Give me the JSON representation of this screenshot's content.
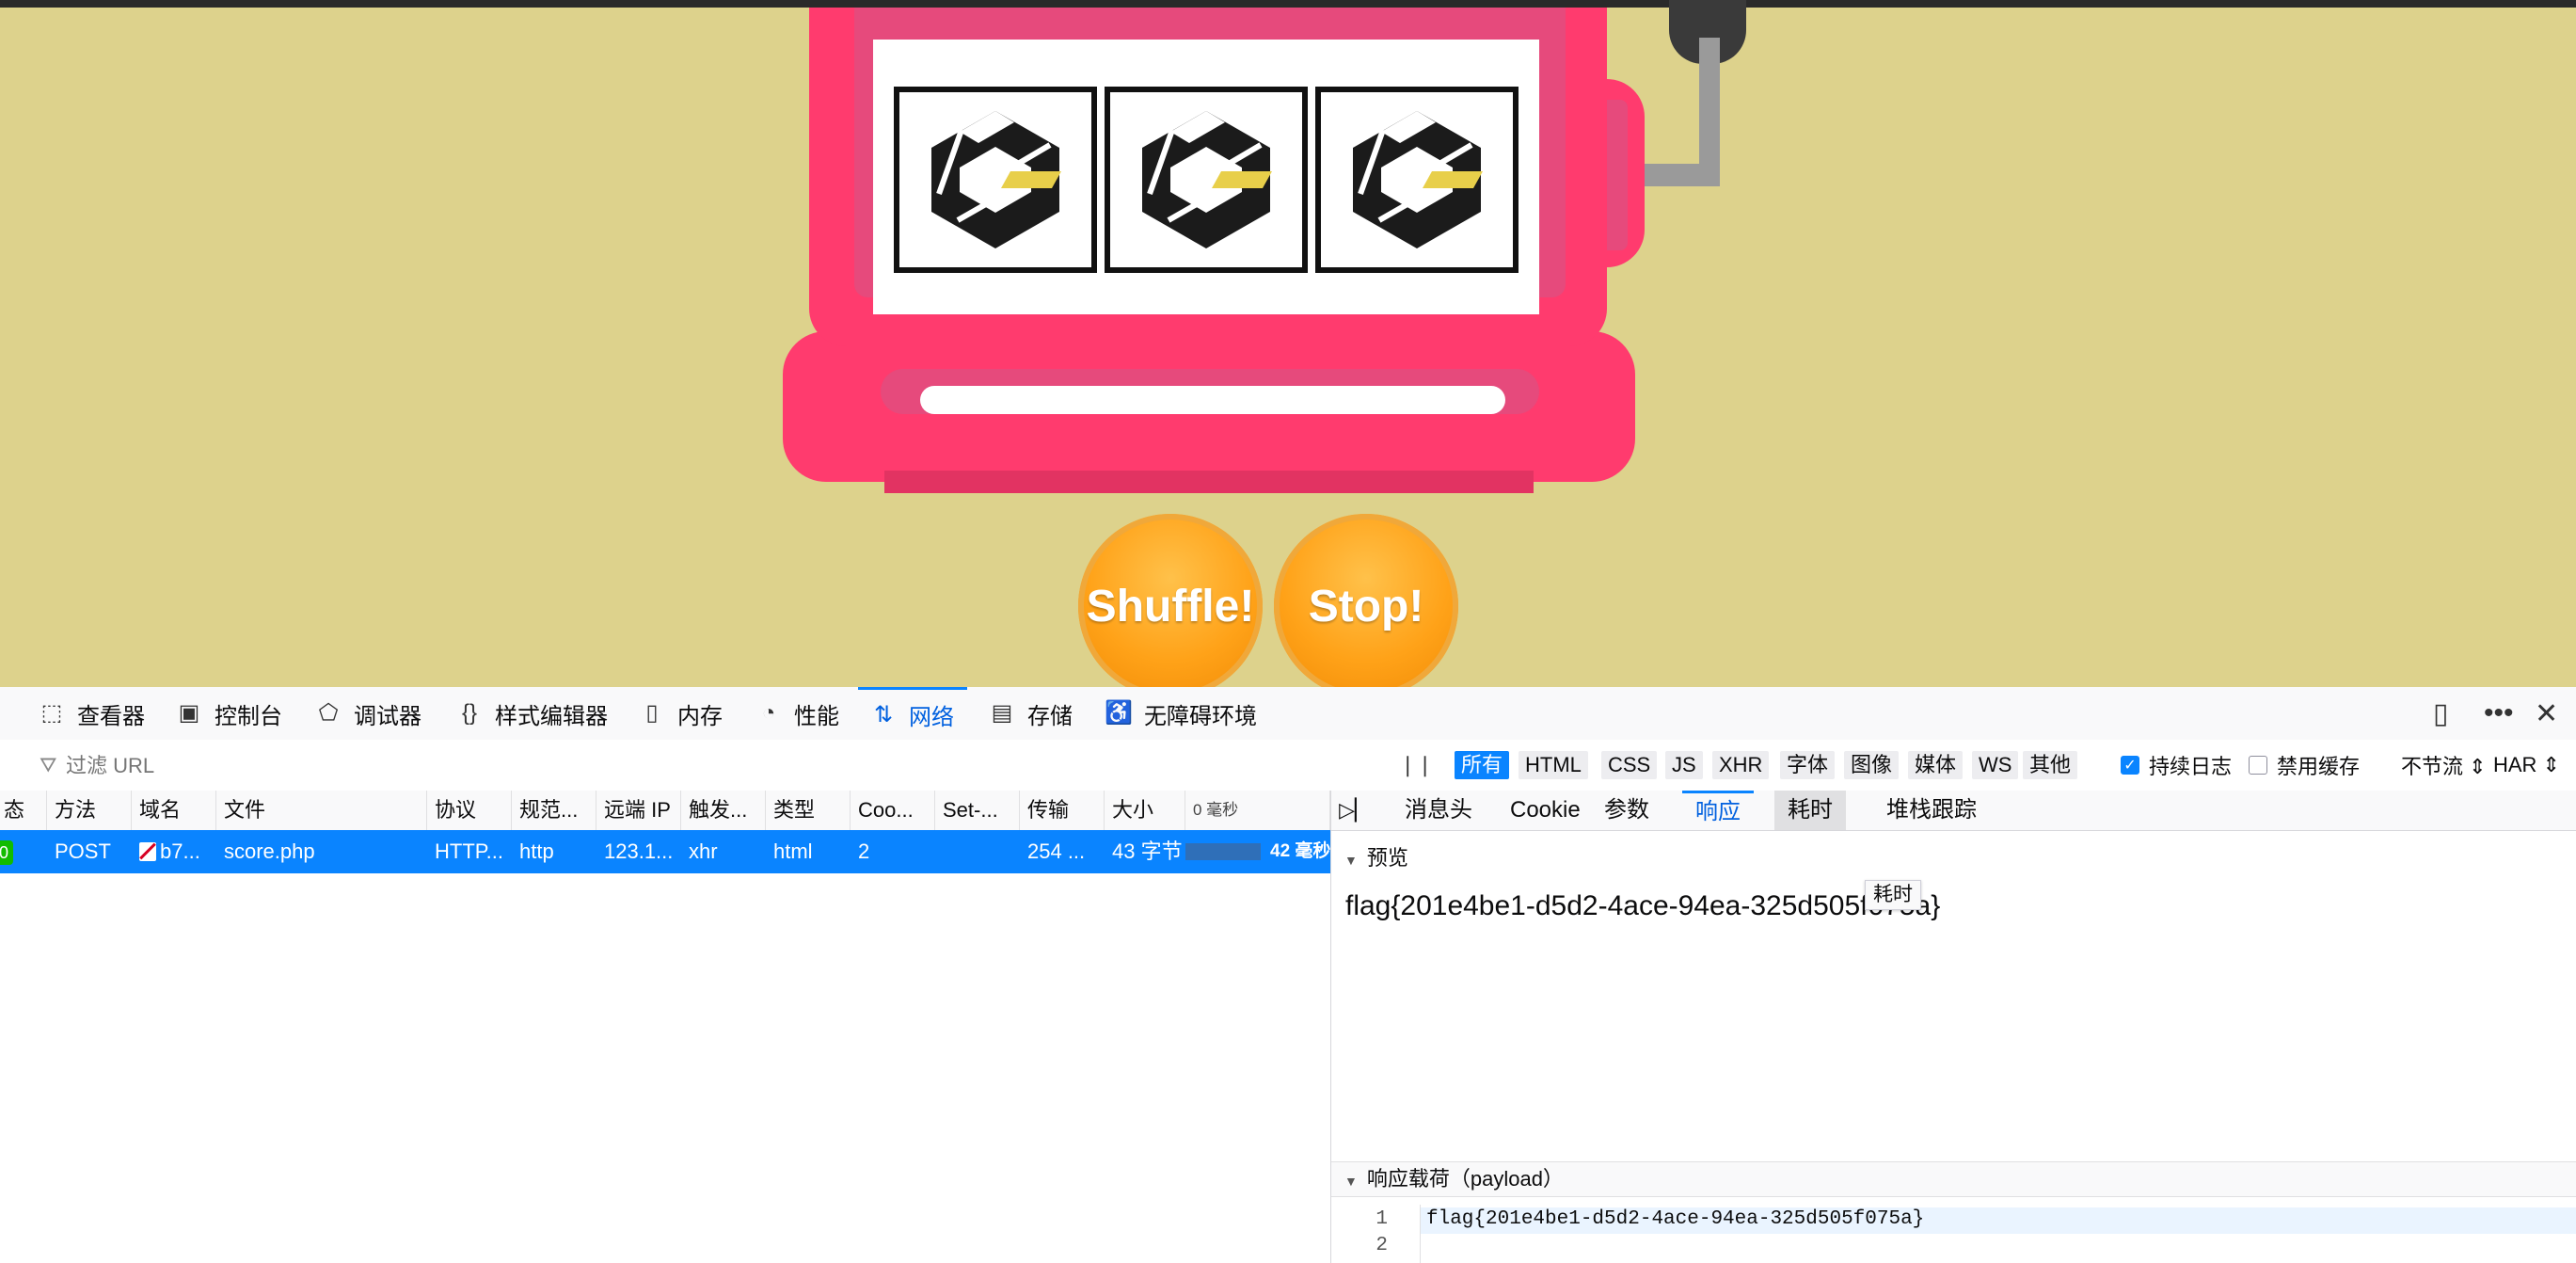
{
  "game": {
    "shuffle_label": "Shuffle!",
    "stop_label": "Stop!",
    "reel_icon": "cube-logo-icon",
    "colors": {
      "background": "#ddd28c",
      "machine": "#ff3b6e",
      "button": "#ffa218",
      "logo_accent": "#e8cf4a"
    }
  },
  "devtools": {
    "tabs": [
      {
        "icon": "inspector-icon",
        "label": "查看器"
      },
      {
        "icon": "console-icon",
        "label": "控制台"
      },
      {
        "icon": "debugger-icon",
        "label": "调试器"
      },
      {
        "icon": "style-editor-icon",
        "label": "样式编辑器"
      },
      {
        "icon": "memory-icon",
        "label": "内存"
      },
      {
        "icon": "performance-icon",
        "label": "性能"
      },
      {
        "icon": "network-icon",
        "label": "网络"
      },
      {
        "icon": "storage-icon",
        "label": "存储"
      },
      {
        "icon": "accessibility-icon",
        "label": "无障碍环境"
      }
    ],
    "active_tab": "网络",
    "filter": {
      "placeholder": "过滤 URL",
      "value": ""
    },
    "type_filters": [
      "所有",
      "HTML",
      "CSS",
      "JS",
      "XHR",
      "字体",
      "图像",
      "媒体",
      "WS",
      "其他"
    ],
    "active_type_filter": "所有",
    "persist_logs": {
      "label": "持续日志",
      "checked": true
    },
    "disable_cache": {
      "label": "禁用缓存",
      "checked": false
    },
    "throttling": "不节流 ⇕",
    "har": "HAR ⇕",
    "columns": [
      "态",
      "方法",
      "域名",
      "文件",
      "协议",
      "规范...",
      "远端 IP",
      "触发...",
      "类型",
      "Coo...",
      "Set-...",
      "传输",
      "大小",
      "0 毫秒"
    ],
    "requests": [
      {
        "status": "0",
        "method": "POST",
        "domain": "b7...",
        "file": "score.php",
        "protocol": "HTTP...",
        "scheme": "http",
        "remote_ip": "123.1...",
        "initiator": "xhr",
        "type": "html",
        "cookies": "2",
        "set_cookies": "",
        "transferred": "254 ...",
        "size": "43 字节",
        "time": "42 毫秒"
      }
    ],
    "detail_tabs": [
      "消息头",
      "Cookie",
      "参数",
      "响应",
      "耗时",
      "堆栈跟踪"
    ],
    "active_detail_tab": "响应",
    "hover_tooltip": "耗时",
    "preview_section": "预览",
    "preview_text": "flag{201e4be1-d5d2-4ace-94ea-325d505f075a}",
    "payload_section": "响应载荷（payload）",
    "payload_lines": [
      {
        "n": "1",
        "text": "flag{201e4be1-d5d2-4ace-94ea-325d505f075a}"
      },
      {
        "n": "2",
        "text": ""
      }
    ]
  }
}
